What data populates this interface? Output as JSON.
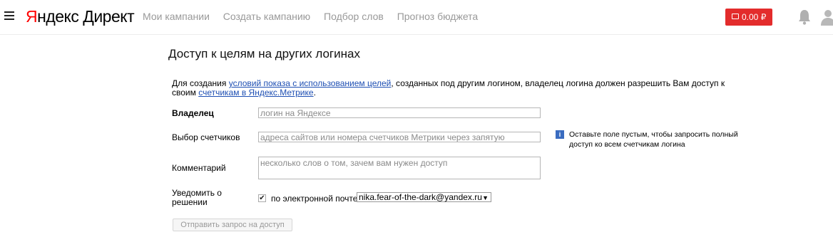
{
  "header": {
    "logo_yandex_letter": "Я",
    "logo_rest": "ндекс Директ",
    "nav": [
      "Мои кампании",
      "Создать кампанию",
      "Подбор слов",
      "Прогноз бюджета"
    ],
    "balance": "0.00 ₽"
  },
  "form": {
    "title": "Доступ к целям на других логинах",
    "intro_prefix": "Для создания ",
    "intro_link1": "условий показа с использованием целей",
    "intro_middle": ", созданных под другим логином, владелец логина должен разрешить Вам доступ к своим ",
    "intro_link2": "счетчикам в Яндекс.Метрике",
    "intro_suffix": ".",
    "owner_label": "Владелец",
    "owner_placeholder": "логин на Яндексе",
    "counters_label": "Выбор счетчиков",
    "counters_placeholder": "адреса сайтов или номера счетчиков Метрики через запятую",
    "hint_icon": "i",
    "hint": "Оставьте поле пустым, чтобы запросить полный доступ ко всем счетчикам логина",
    "comment_label": "Комментарий",
    "comment_placeholder": "несколько слов о том, зачем вам нужен доступ",
    "notify_label": "Уведомить о решении",
    "notify_checked": true,
    "notify_checkmark": "✔",
    "notify_option": "по электронной почте",
    "email": "nika.fear-of-the-dark@yandex.ru",
    "submit": "Отправить запрос на доступ"
  },
  "icons": [
    "menu-icon",
    "wallet-icon",
    "bell-icon",
    "user-icon",
    "info-icon",
    "dropdown-arrow-icon"
  ]
}
